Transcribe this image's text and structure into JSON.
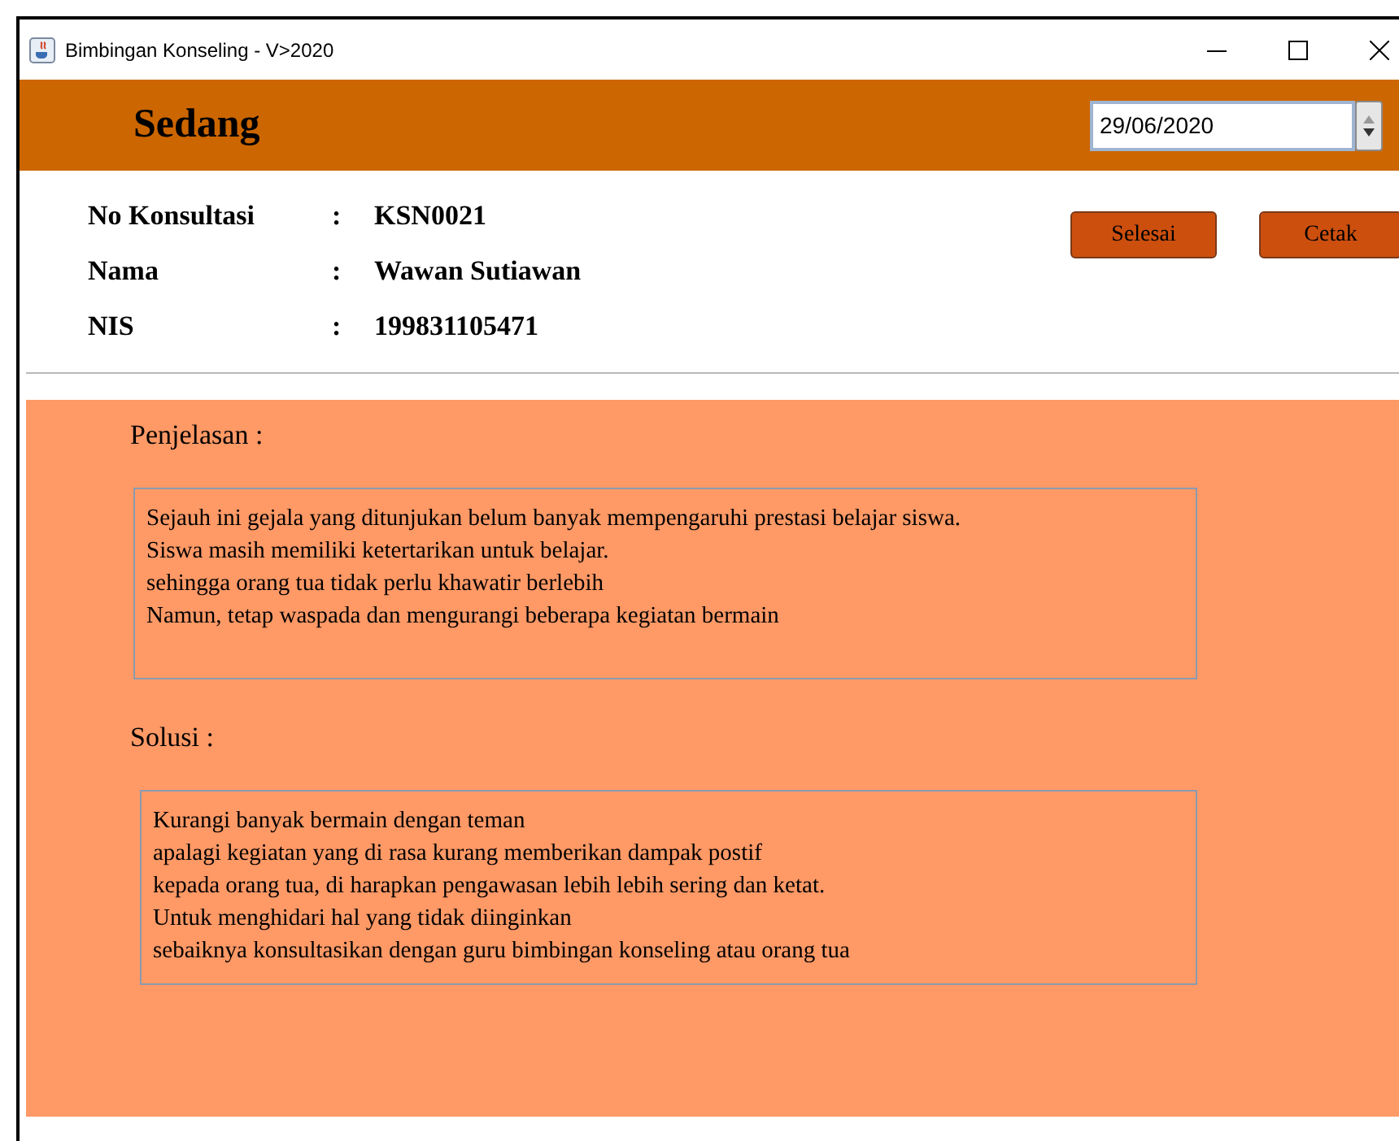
{
  "window": {
    "title": "Bimbingan Konseling - V>2020"
  },
  "header": {
    "title": "Sedang",
    "date": "29/06/2020"
  },
  "info": [
    {
      "label": "No Konsultasi",
      "separator": ":",
      "value": "KSN0021"
    },
    {
      "label": "Nama",
      "separator": ":",
      "value": "Wawan Sutiawan"
    },
    {
      "label": "NIS",
      "separator": ":",
      "value": "199831105471"
    }
  ],
  "buttons": [
    "Selesai",
    "Cetak"
  ],
  "sections": [
    {
      "label": "Penjelasan :",
      "text": "Sejauh ini gejala yang ditunjukan belum banyak mempengaruhi prestasi belajar siswa.\nSiswa masih memiliki ketertarikan untuk belajar.\nsehingga orang tua tidak perlu khawatir berlebih\nNamun, tetap waspada dan mengurangi beberapa kegiatan bermain"
    },
    {
      "label": "Solusi :",
      "text": "Kurangi banyak bermain dengan teman\napalagi kegiatan yang di rasa kurang memberikan dampak postif\nkepada orang tua, di harapkan pengawasan lebih lebih sering dan ketat.\nUntuk menghidari hal yang tidak diinginkan\nsebaiknya konsultasikan dengan guru bimbingan konseling atau orang tua"
    }
  ]
}
